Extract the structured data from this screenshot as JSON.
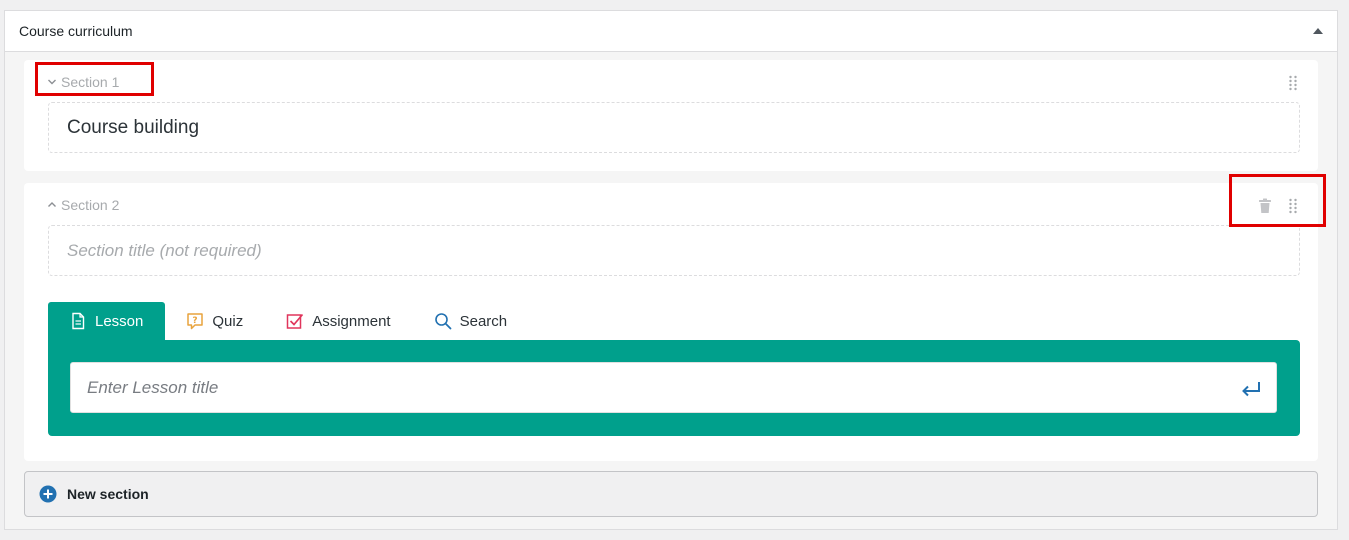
{
  "panel": {
    "title": "Course curriculum"
  },
  "sections": [
    {
      "label": "Section 1",
      "title_value": "Course building",
      "title_placeholder": ""
    },
    {
      "label": "Section 2",
      "title_value": "",
      "title_placeholder": "Section title (not required)"
    }
  ],
  "tabs": [
    {
      "label": "Lesson",
      "icon": "document-icon",
      "active": true
    },
    {
      "label": "Quiz",
      "icon": "quiz-icon",
      "active": false
    },
    {
      "label": "Assignment",
      "icon": "assignment-icon",
      "active": false
    },
    {
      "label": "Search",
      "icon": "search-icon",
      "active": false
    }
  ],
  "lesson_input": {
    "value": "",
    "placeholder": "Enter Lesson title"
  },
  "new_section": {
    "label": "New section"
  },
  "colors": {
    "accent": "#00a08c",
    "highlight": "#e00000",
    "link_blue": "#2271b1",
    "quiz_orange": "#e8a33d",
    "assignment_red": "#e0355c"
  }
}
